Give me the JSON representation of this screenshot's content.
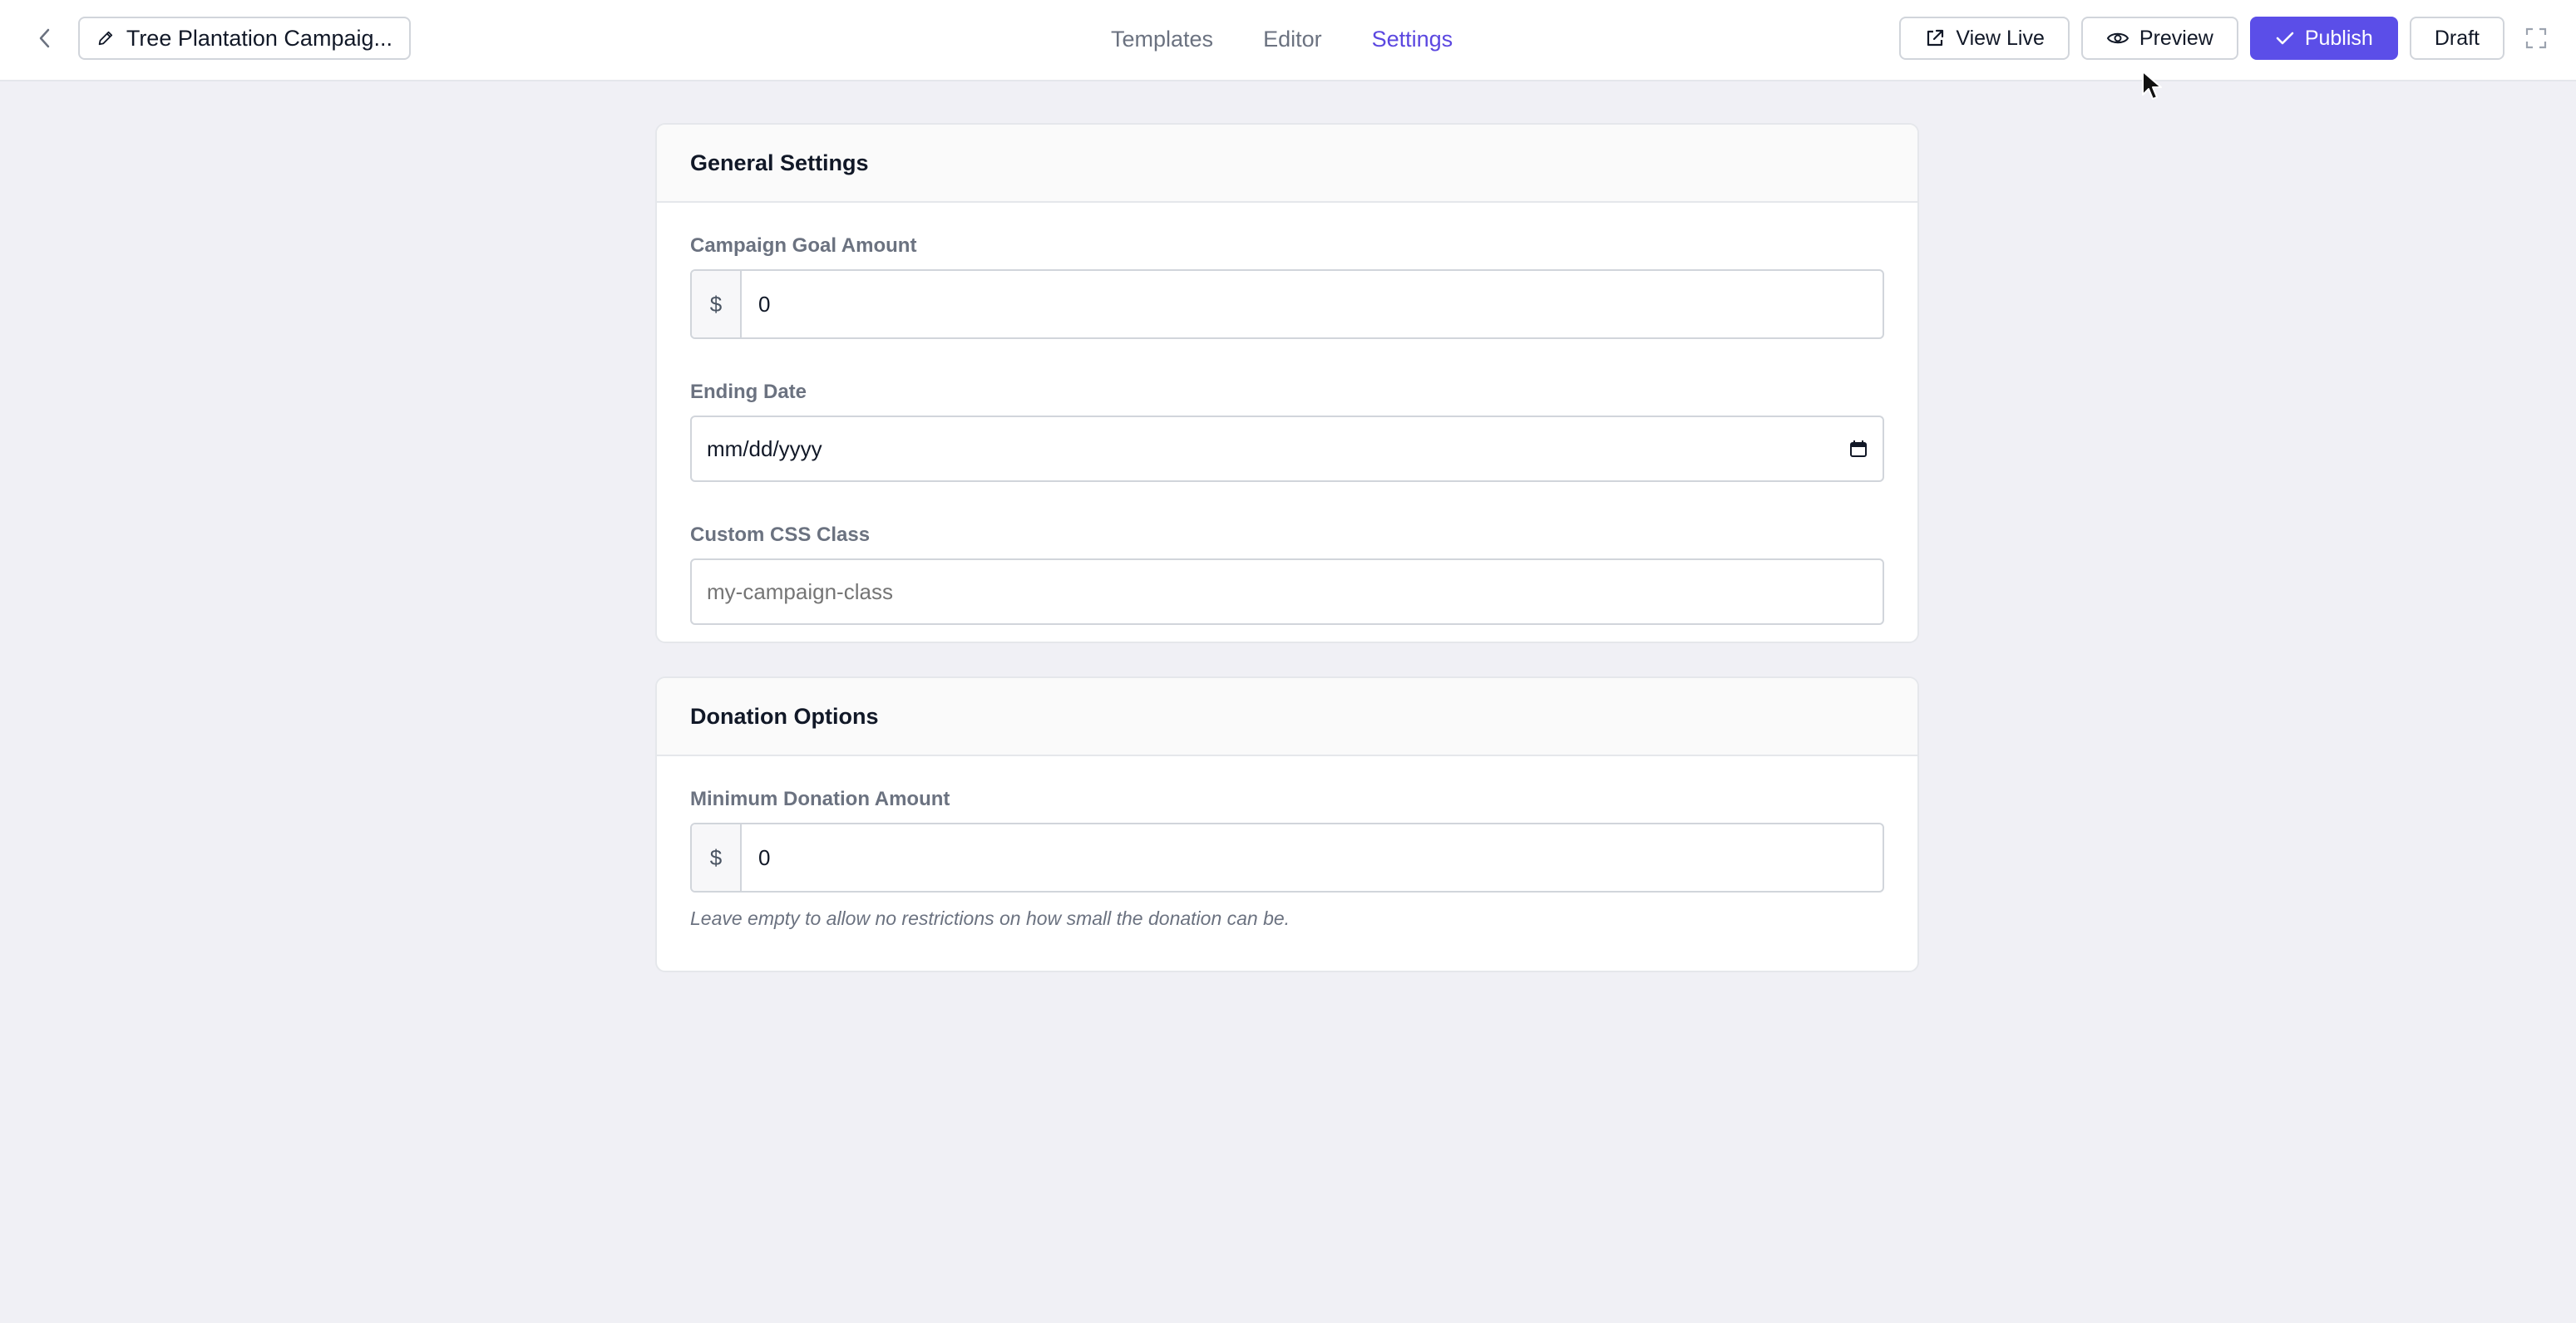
{
  "header": {
    "campaign_title": "Tree Plantation Campaig...",
    "tabs": [
      {
        "label": "Templates",
        "active": false
      },
      {
        "label": "Editor",
        "active": false
      },
      {
        "label": "Settings",
        "active": true
      }
    ],
    "actions": {
      "view_live": "View Live",
      "preview": "Preview",
      "publish": "Publish",
      "draft": "Draft"
    }
  },
  "general_settings": {
    "title": "General Settings",
    "goal_label": "Campaign Goal Amount",
    "goal_currency": "$",
    "goal_value": "0",
    "end_date_label": "Ending Date",
    "end_date_placeholder": "mm/dd/yyyy",
    "css_class_label": "Custom CSS Class",
    "css_class_placeholder": "my-campaign-class"
  },
  "donation_options": {
    "title": "Donation Options",
    "min_label": "Minimum Donation Amount",
    "min_currency": "$",
    "min_value": "0",
    "help_text": "Leave empty to allow no restrictions on how small the donation can be."
  },
  "colors": {
    "accent": "#5b4ee8",
    "active_tab": "#5b47e0",
    "background": "#f0f0f5"
  }
}
